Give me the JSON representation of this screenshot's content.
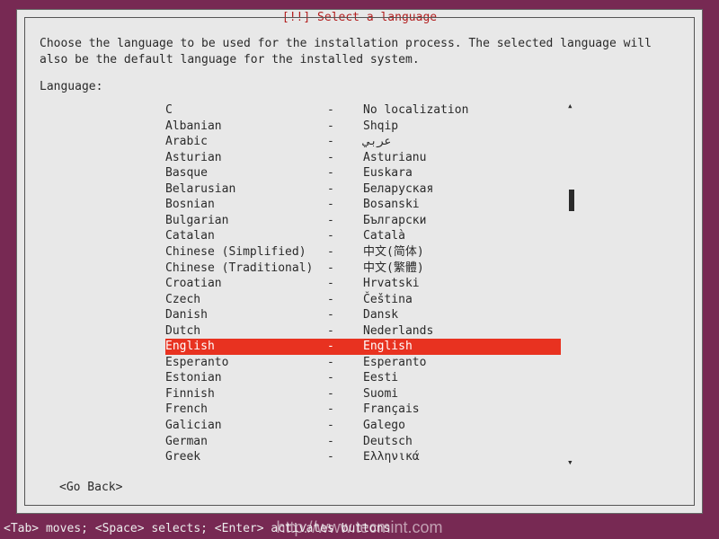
{
  "dialog": {
    "title": "[!!] Select a language",
    "instructions": "Choose the language to be used for the installation process. The selected language will also be the default language for the installed system.",
    "label": "Language:",
    "goback": "<Go Back>"
  },
  "languages": [
    {
      "name": "C",
      "sep": "-",
      "native": "No localization",
      "selected": false
    },
    {
      "name": "Albanian",
      "sep": "-",
      "native": "Shqip",
      "selected": false
    },
    {
      "name": "Arabic",
      "sep": "-",
      "native": "عربي",
      "selected": false
    },
    {
      "name": "Asturian",
      "sep": "-",
      "native": "Asturianu",
      "selected": false
    },
    {
      "name": "Basque",
      "sep": "-",
      "native": "Euskara",
      "selected": false
    },
    {
      "name": "Belarusian",
      "sep": "-",
      "native": "Беларуская",
      "selected": false
    },
    {
      "name": "Bosnian",
      "sep": "-",
      "native": "Bosanski",
      "selected": false
    },
    {
      "name": "Bulgarian",
      "sep": "-",
      "native": "Български",
      "selected": false
    },
    {
      "name": "Catalan",
      "sep": "-",
      "native": "Català",
      "selected": false
    },
    {
      "name": "Chinese (Simplified)",
      "sep": "-",
      "native": "中文(简体)",
      "selected": false
    },
    {
      "name": "Chinese (Traditional)",
      "sep": "-",
      "native": "中文(繁體)",
      "selected": false
    },
    {
      "name": "Croatian",
      "sep": "-",
      "native": "Hrvatski",
      "selected": false
    },
    {
      "name": "Czech",
      "sep": "-",
      "native": "Čeština",
      "selected": false
    },
    {
      "name": "Danish",
      "sep": "-",
      "native": "Dansk",
      "selected": false
    },
    {
      "name": "Dutch",
      "sep": "-",
      "native": "Nederlands",
      "selected": false
    },
    {
      "name": "English",
      "sep": "-",
      "native": "English",
      "selected": true
    },
    {
      "name": "Esperanto",
      "sep": "-",
      "native": "Esperanto",
      "selected": false
    },
    {
      "name": "Estonian",
      "sep": "-",
      "native": "Eesti",
      "selected": false
    },
    {
      "name": "Finnish",
      "sep": "-",
      "native": "Suomi",
      "selected": false
    },
    {
      "name": "French",
      "sep": "-",
      "native": "Français",
      "selected": false
    },
    {
      "name": "Galician",
      "sep": "-",
      "native": "Galego",
      "selected": false
    },
    {
      "name": "German",
      "sep": "-",
      "native": "Deutsch",
      "selected": false
    },
    {
      "name": "Greek",
      "sep": "-",
      "native": "Ελληνικά",
      "selected": false
    }
  ],
  "scroll": {
    "up_glyph": "▴",
    "down_glyph": "▾",
    "thumb_top_pct": 24,
    "thumb_height_pct": 6
  },
  "statusbar": "<Tab> moves; <Space> selects; <Enter> activates buttons",
  "watermark": "http://www.tecmint.com"
}
